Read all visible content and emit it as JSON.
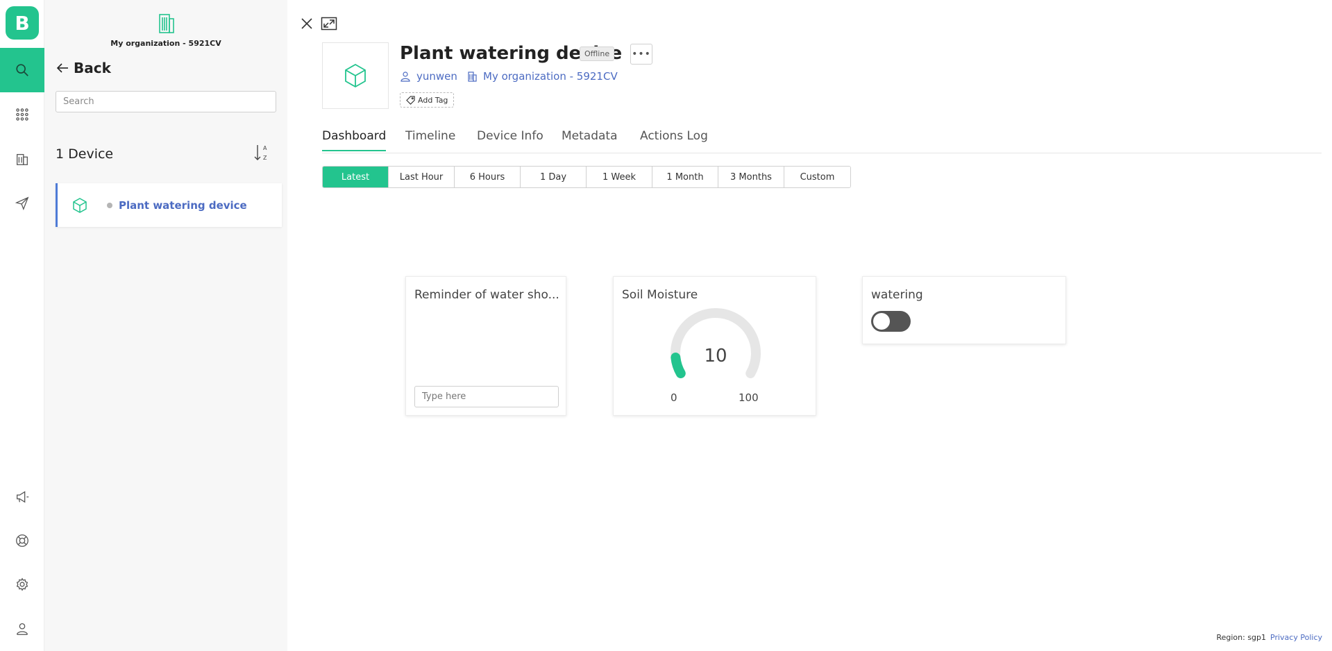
{
  "sidebar": {
    "org_name": "My organization - 5921CV",
    "back_label": "Back",
    "search_placeholder": "Search",
    "device_count": "1 Device",
    "devices": [
      {
        "name": "Plant watering device",
        "status": "offline"
      }
    ]
  },
  "device": {
    "title": "Plant watering device",
    "status_badge": "Offline",
    "more_label": "•••",
    "owner": "yunwen",
    "organization": "My organization - 5921CV",
    "add_tag_label": "Add Tag"
  },
  "tabs": [
    "Dashboard",
    "Timeline",
    "Device Info",
    "Metadata",
    "Actions Log"
  ],
  "active_tab": "Dashboard",
  "time_ranges": [
    "Latest",
    "Last Hour",
    "6 Hours",
    "1 Day",
    "1 Week",
    "1 Month",
    "3 Months",
    "Custom"
  ],
  "active_range": "Latest",
  "widgets": {
    "reminder": {
      "title": "Reminder of water sho...",
      "input_placeholder": "Type here"
    },
    "soil": {
      "title": "Soil Moisture",
      "value": "10",
      "min": "0",
      "max": "100",
      "level": 0.1
    },
    "watering": {
      "title": "watering",
      "state": "off"
    }
  },
  "footer": {
    "region": "Region: sgp1",
    "privacy": "Privacy Policy"
  },
  "colors": {
    "accent": "#23c48e",
    "link": "#4c6bc2"
  }
}
